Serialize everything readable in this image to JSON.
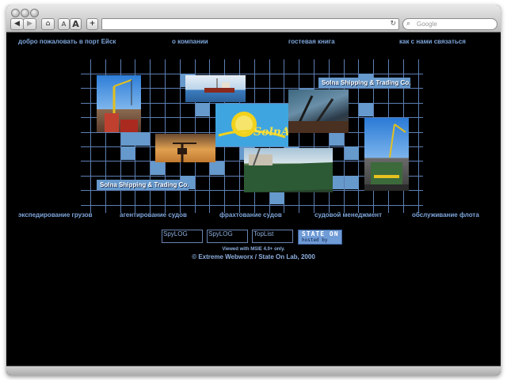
{
  "browser": {
    "search_placeholder": "Google",
    "url": "",
    "back_icon": "back-arrow-icon",
    "forward_icon": "forward-arrow-icon",
    "home_icon": "home-icon",
    "text_smaller": "A",
    "text_larger": "A",
    "add_bookmark": "+",
    "reload_icon": "reload-icon"
  },
  "colors": {
    "background": "#000000",
    "accent": "#6699cc",
    "link": "#7ea6dc"
  },
  "top_nav": [
    {
      "label": "добро пожаловать в порт Ейск"
    },
    {
      "label": "о компании"
    },
    {
      "label": "гостевая книга"
    },
    {
      "label": "как с нами связаться"
    }
  ],
  "collage": {
    "brand_top": "Solna Shipping & Trading Co.",
    "brand_bottom": "Solna Shipping & Trading Co.",
    "logo_text": "SolnA"
  },
  "bottom_nav": [
    {
      "label": "экспедирование грузов"
    },
    {
      "label": "агентирование судов"
    },
    {
      "label": "фрахтование судов"
    },
    {
      "label": "судовой менеджмент"
    },
    {
      "label": "обслуживание флота"
    }
  ],
  "counters": [
    {
      "label": "SpyLOG"
    },
    {
      "label": "SpyLOG"
    },
    {
      "label": "TopList"
    }
  ],
  "hosting_badge": {
    "line1": "STATE ON",
    "line2": "hosted by"
  },
  "footer": {
    "viewed_note": "Viewed with MSIE 4.0+ only.",
    "copyright": "© Extreme Webworx / State On Lab, 2000"
  }
}
